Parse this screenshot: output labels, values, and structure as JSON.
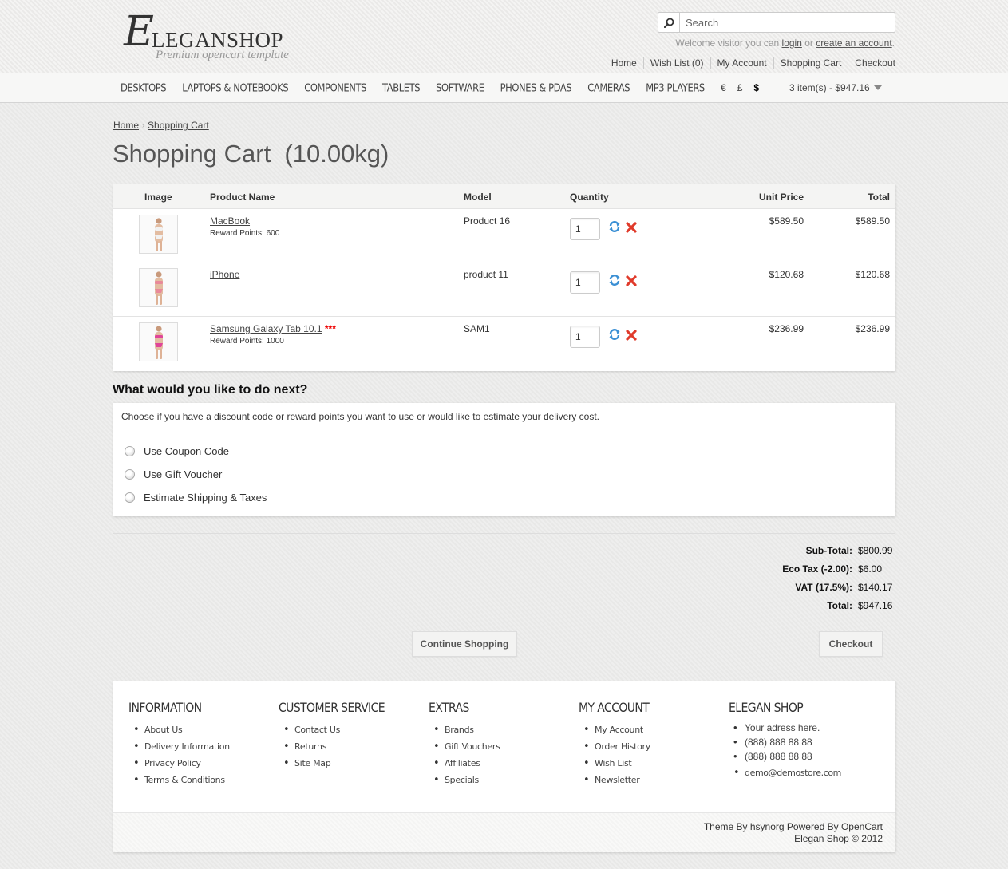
{
  "logo": {
    "initial": "E",
    "name": "LEGANSHOP",
    "tagline": "Premium opencart template"
  },
  "search": {
    "placeholder": "Search"
  },
  "welcome": {
    "prefix": "Welcome visitor you can",
    "login": "login",
    "or": "or",
    "register": "create an account",
    "suffix": "."
  },
  "top_links": [
    "Home",
    "Wish List (0)",
    "My Account",
    "Shopping Cart",
    "Checkout"
  ],
  "menu": [
    "DESKTOPS",
    "LAPTOPS & NOTEBOOKS",
    "COMPONENTS",
    "TABLETS",
    "SOFTWARE",
    "PHONES & PDAS",
    "CAMERAS",
    "MP3 PLAYERS"
  ],
  "currencies": [
    {
      "symbol": "€",
      "active": false
    },
    {
      "symbol": "£",
      "active": false
    },
    {
      "symbol": "$",
      "active": true
    }
  ],
  "cart_summary": "3 item(s) - $947.16",
  "breadcrumb": [
    "Home",
    "Shopping Cart"
  ],
  "page_title": "Shopping Cart  (10.00kg)",
  "cart": {
    "headers": {
      "image": "Image",
      "name": "Product Name",
      "model": "Model",
      "quantity": "Quantity",
      "unit_price": "Unit Price",
      "total": "Total"
    },
    "rows": [
      {
        "name": "MacBook",
        "stars": "",
        "reward": "Reward Points: 600",
        "model": "Product 16",
        "qty": "1",
        "unit_price": "$589.50",
        "total": "$589.50",
        "swatch": "#f2f2f2"
      },
      {
        "name": "iPhone",
        "stars": "",
        "reward": "",
        "model": "product 11",
        "qty": "1",
        "unit_price": "$120.68",
        "total": "$120.68",
        "swatch": "#e9899a"
      },
      {
        "name": "Samsung Galaxy Tab 10.1",
        "stars": "***",
        "reward": "Reward Points: 1000",
        "model": "SAM1",
        "qty": "1",
        "unit_price": "$236.99",
        "total": "$236.99",
        "swatch": "#e0459a"
      }
    ]
  },
  "next": {
    "heading": "What would you like to do next?",
    "intro": "Choose if you have a discount code or reward points you want to use or would like to estimate your delivery cost.",
    "options": [
      "Use Coupon Code",
      "Use Gift Voucher",
      "Estimate Shipping & Taxes"
    ]
  },
  "totals": [
    {
      "label": "Sub-Total:",
      "value": "$800.99"
    },
    {
      "label": "Eco Tax (-2.00):",
      "value": "$6.00"
    },
    {
      "label": "VAT (17.5%):",
      "value": "$140.17"
    },
    {
      "label": "Total:",
      "value": "$947.16"
    }
  ],
  "buttons": {
    "continue": "Continue Shopping",
    "checkout": "Checkout"
  },
  "footer": {
    "columns": [
      {
        "title": "INFORMATION",
        "items": [
          "About Us",
          "Delivery Information",
          "Privacy Policy",
          "Terms & Conditions"
        ]
      },
      {
        "title": "CUSTOMER SERVICE",
        "items": [
          "Contact Us",
          "Returns",
          "Site Map"
        ]
      },
      {
        "title": "EXTRAS",
        "items": [
          "Brands",
          "Gift Vouchers",
          "Affiliates",
          "Specials"
        ]
      },
      {
        "title": "MY ACCOUNT",
        "items": [
          "My Account",
          "Order History",
          "Wish List",
          "Newsletter"
        ]
      }
    ],
    "shop": {
      "title": "ELEGAN SHOP",
      "address": "Your adress here.",
      "phone1": "(888) 888 88 88",
      "phone2": "(888) 888 88 88",
      "email": "demo@demostore.com"
    },
    "credits": {
      "theme_prefix": "Theme By",
      "theme_author": "hsynorg",
      "powered_prefix": "Powered By",
      "powered_link": "OpenCart",
      "copyright": "Elegan Shop © 2012"
    }
  },
  "colors": {
    "accent_red": "#e00000",
    "background": "#ebebea",
    "refresh_icon": "#3a8fd4",
    "remove_icon": "#e03a2a"
  }
}
